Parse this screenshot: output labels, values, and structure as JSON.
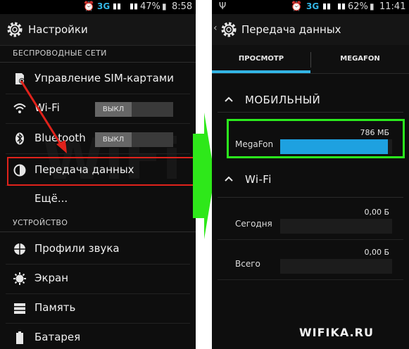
{
  "left_screen": {
    "status": {
      "network": "3G",
      "signal_bars": "▮▮",
      "battery_percent": "47%",
      "time": "8:58"
    },
    "title": "Настройки",
    "sections": [
      {
        "header": "БЕСПРОВОДНЫЕ СЕТИ"
      },
      {
        "header": "УСТРОЙСТВО"
      }
    ],
    "items": [
      {
        "label": "Управление SIM-картами",
        "icon": "sim-card-icon"
      },
      {
        "label": "Wi-Fi",
        "icon": "wifi-icon",
        "toggle": "ВЫКЛ"
      },
      {
        "label": "Bluetooth",
        "icon": "bluetooth-icon",
        "toggle": "ВЫКЛ"
      },
      {
        "label": "Передача данных",
        "icon": "data-usage-icon",
        "highlighted": true
      },
      {
        "label": "Ещё...",
        "icon": ""
      },
      {
        "label": "Профили звука",
        "icon": "sound-icon"
      },
      {
        "label": "Экран",
        "icon": "display-icon"
      },
      {
        "label": "Память",
        "icon": "storage-icon"
      },
      {
        "label": "Батарея",
        "icon": "battery-icon"
      }
    ]
  },
  "right_screen": {
    "status": {
      "usb": "Ψ",
      "network": "3G",
      "signal_bars": "▮▮",
      "battery_percent": "62%",
      "time": "11:41"
    },
    "title": "Передача данных",
    "tabs": [
      {
        "label": "ПРОСМОТР",
        "active": true
      },
      {
        "label": "MEGAFON",
        "active": false
      }
    ],
    "groups": [
      {
        "title": "МОБИЛЬНЫЙ",
        "rows": [
          {
            "name": "MegaFon",
            "value": "786 МБ",
            "fill_fraction": 0.96
          }
        ]
      },
      {
        "title": "Wi-Fi",
        "rows": [
          {
            "name": "Сегодня",
            "value": "0,00 Б",
            "fill_fraction": 0
          },
          {
            "name": "Всего",
            "value": "0,00 Б",
            "fill_fraction": 0
          }
        ]
      }
    ]
  },
  "watermark": {
    "text": "WIFIKA.RU"
  },
  "colors": {
    "accent": "#33b5e5",
    "bar_fill": "#1ea1e0",
    "highlight_red": "#e0221b",
    "highlight_green": "#2bea1d"
  }
}
